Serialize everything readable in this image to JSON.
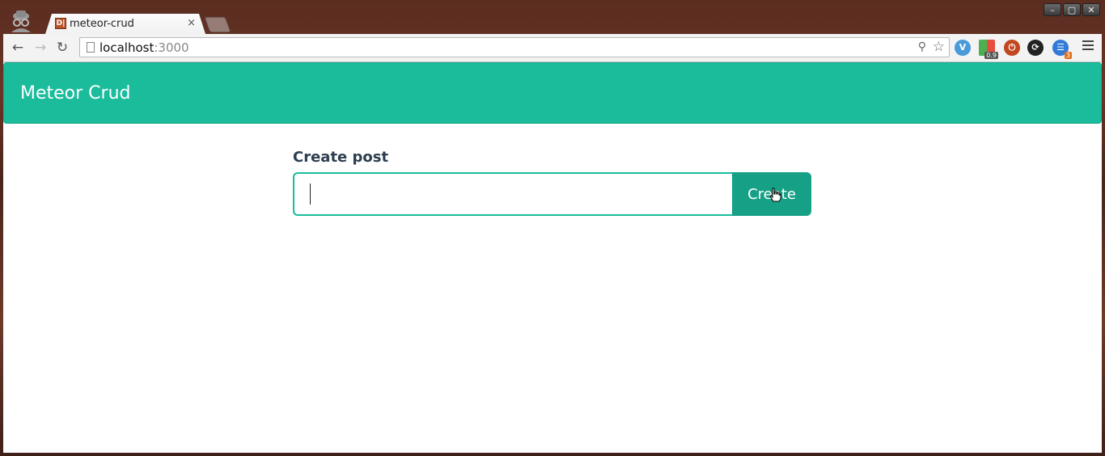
{
  "browser": {
    "tab": {
      "title": "meteor-crud",
      "favicon_letters": "D|",
      "close_glyph": "×"
    },
    "address_bar": {
      "host": "localhost",
      "port": ":3000"
    },
    "window_controls": [
      "–",
      "▢",
      "✕"
    ],
    "nav": {
      "back": "←",
      "forward": "→",
      "reload": "↻"
    },
    "extensions": [
      {
        "name": "vimium-extension-icon",
        "glyph": "V",
        "color": "#4a9ad8"
      },
      {
        "name": "tag-extension-icon",
        "glyph": "",
        "color": "#c62f1b",
        "badge": "0.9"
      },
      {
        "name": "power-extension-icon",
        "glyph": "⏻",
        "color": "#c0471f"
      },
      {
        "name": "sync-extension-icon",
        "glyph": "⟳",
        "color": "#222222"
      },
      {
        "name": "signal-extension-icon",
        "glyph": "☰",
        "color": "#2f7bd6",
        "badge": "3"
      }
    ]
  },
  "app": {
    "brand": "Meteor Crud",
    "form": {
      "label": "Create post",
      "input_value": "",
      "button_label": "Create"
    },
    "colors": {
      "primary": "#1abc9c",
      "button": "#16a085",
      "label": "#2c3e50"
    }
  }
}
